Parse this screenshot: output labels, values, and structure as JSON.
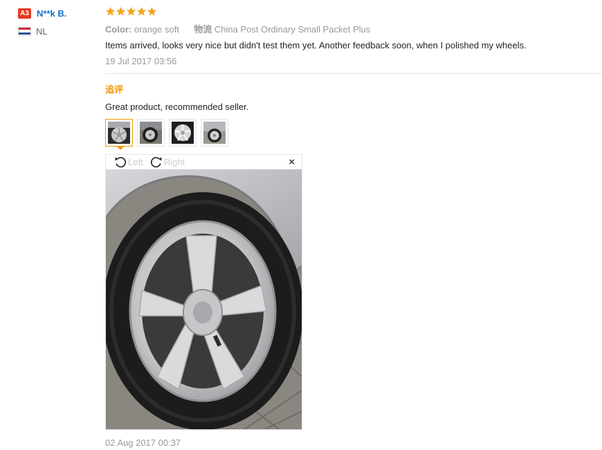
{
  "reviewer": {
    "level": "A3",
    "name": "N**k B.",
    "country": "NL"
  },
  "rating": {
    "stars": 5,
    "star_color": "#f5a623"
  },
  "meta": {
    "color_label": "Color:",
    "color_value": "orange soft",
    "shipping_label": "物流",
    "shipping_value": "China Post Ordinary Small Packet Plus"
  },
  "review": {
    "text": "Items arrived, looks very nice but didn't test them yet. Another feedback soon, when I polished my wheels.",
    "date": "19 Jul 2017 03:56"
  },
  "additional": {
    "label": "追评",
    "text": "Great product, recommended seller.",
    "thumbnails": [
      "photo-1",
      "photo-2",
      "photo-3",
      "photo-4"
    ],
    "active_thumbnail": 1,
    "date": "02 Aug 2017 00:37"
  },
  "viewer": {
    "rotate_left_label": "Left",
    "rotate_right_label": "Right",
    "close_label": "×"
  },
  "colors": {
    "accent": "#f39800",
    "link": "#1a6fd0",
    "badge": "#e43b24"
  }
}
